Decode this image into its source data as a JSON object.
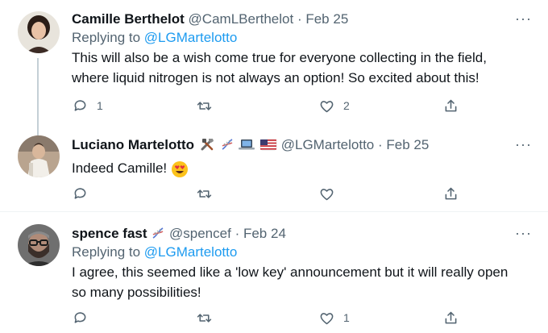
{
  "tweets": [
    {
      "name": "Camille Berthelot",
      "handle": "@CamLBerthelot",
      "dot": "·",
      "date": "Feb 25",
      "replying_prefix": "Replying to ",
      "replying_to": "@LGMartelotto",
      "text_line1": "This will also be a wish come true for everyone collecting in the field,",
      "text_line2": "where liquid nitrogen is not always an option! So excited about this!",
      "reply_count": "1",
      "retweet_count": "",
      "like_count": "2"
    },
    {
      "name": "Luciano Martelotto",
      "handle": "@LGMartelotto",
      "dot": "·",
      "date": "Feb 25",
      "name_emojis": [
        "hammer-wrench",
        "dna",
        "laptop",
        "us-flag"
      ],
      "text": "Indeed Camille!",
      "reply_count": "",
      "retweet_count": "",
      "like_count": ""
    },
    {
      "name": "spence fast",
      "handle": "@spencef",
      "dot": "·",
      "date": "Feb 24",
      "name_emojis": [
        "dna"
      ],
      "replying_prefix": "Replying to ",
      "replying_to": "@LGMartelotto",
      "text_line1": "I agree, this seemed like a 'low key' announcement but it will really open",
      "text_line2": "so many possibilities!",
      "reply_count": "",
      "retweet_count": "",
      "like_count": "1"
    }
  ],
  "more_label": "···",
  "colors": {
    "link": "#1d9bf0",
    "muted": "#536471",
    "text": "#0f1419"
  }
}
